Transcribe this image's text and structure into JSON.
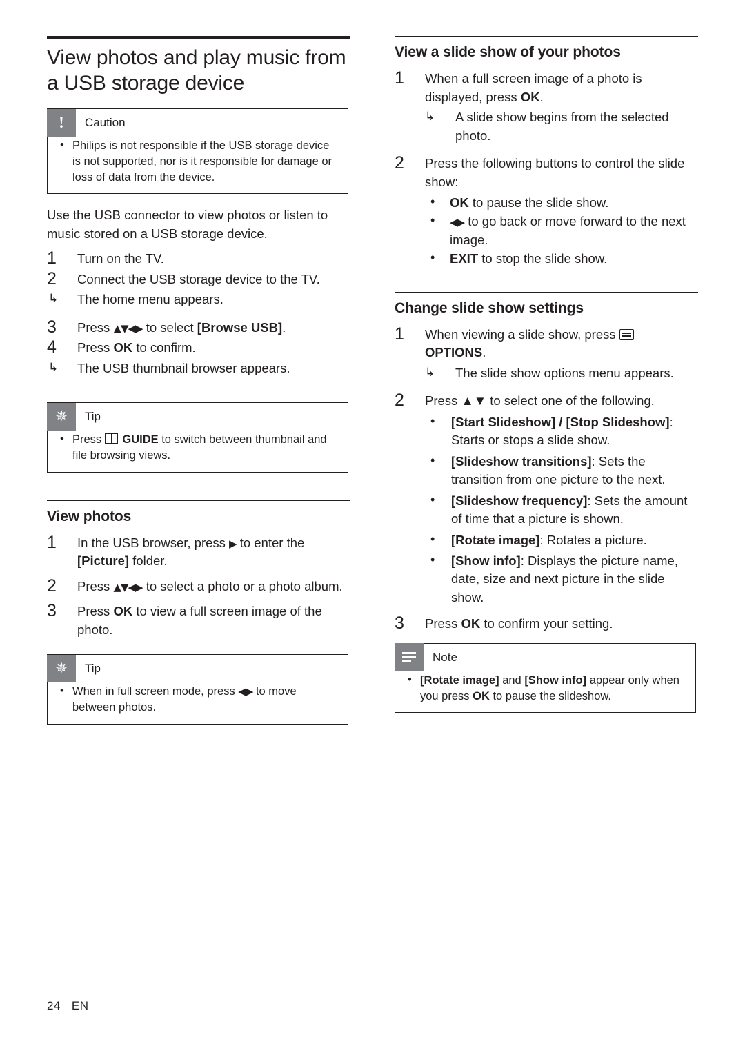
{
  "page": {
    "number": "24",
    "locale": "EN"
  },
  "left": {
    "title": "View photos and play music from a USB storage device",
    "caution": {
      "label": "Caution",
      "icon": "exclamation-icon",
      "bullets": [
        "Philips is not responsible if the USB storage device is not supported, nor is it responsible for damage or loss of data from the device."
      ]
    },
    "intro": "Use the USB connector to view photos or listen to music stored on a USB storage device.",
    "steps": [
      {
        "num": "1",
        "text": "Turn on the TV."
      },
      {
        "num": "2",
        "text": "Connect the USB storage device to the TV."
      },
      {
        "num": "3",
        "text": "Press ▲▼◀▶ to select [Browse USB]."
      },
      {
        "num": "4",
        "text": "Press OK to confirm."
      }
    ],
    "step2_result": "The home menu appears.",
    "step4_result": "The USB thumbnail browser appears.",
    "tip1": {
      "label": "Tip",
      "icon": "star-icon",
      "bullets": [
        "Press  GUIDE to switch between thumbnail and file browsing views."
      ]
    },
    "view_photos": {
      "title": "View photos",
      "steps": [
        {
          "num": "1",
          "text": "In the USB browser, press ▶ to enter the [Picture] folder."
        },
        {
          "num": "2",
          "text": "Press ▲▼◀▶ to select a photo or a photo album."
        },
        {
          "num": "3",
          "text": "Press OK to view a full screen image of the photo."
        }
      ]
    },
    "tip2": {
      "label": "Tip",
      "icon": "star-icon",
      "bullets": [
        "When in full screen mode, press ◀▶ to move between photos."
      ]
    }
  },
  "right": {
    "slideshow": {
      "title": "View a slide show of your photos",
      "step1": "When a full screen image of a photo is displayed, press OK.",
      "step1_result": "A slide show begins from the selected photo.",
      "step2": "Press the following buttons to control the slide show:",
      "step2_bullets": [
        "OK to pause the slide show.",
        "◀▶ to go back or move forward to the next image.",
        "EXIT to stop the slide show."
      ]
    },
    "settings": {
      "title": "Change slide show settings",
      "step1": "When viewing a slide show, press  OPTIONS.",
      "step1_result": "The slide show options menu appears.",
      "step2": "Press ▲▼ to select one of the following.",
      "step2_bullets": [
        "[Start Slideshow] / [Stop Slideshow]: Starts or stops a slide show.",
        "[Slideshow transitions]: Sets the transition from one picture to the next.",
        "[Slideshow frequency]: Sets the amount of time that a picture is shown.",
        "[Rotate image]: Rotates a picture.",
        "[Show info]: Displays the picture name, date, size and next picture in the slide show."
      ],
      "step3": "Press OK to confirm your setting."
    },
    "note": {
      "label": "Note",
      "icon": "lines-icon",
      "bullets": [
        "[Rotate image] and [Show info] appear only when you press OK to pause the slideshow."
      ]
    }
  }
}
